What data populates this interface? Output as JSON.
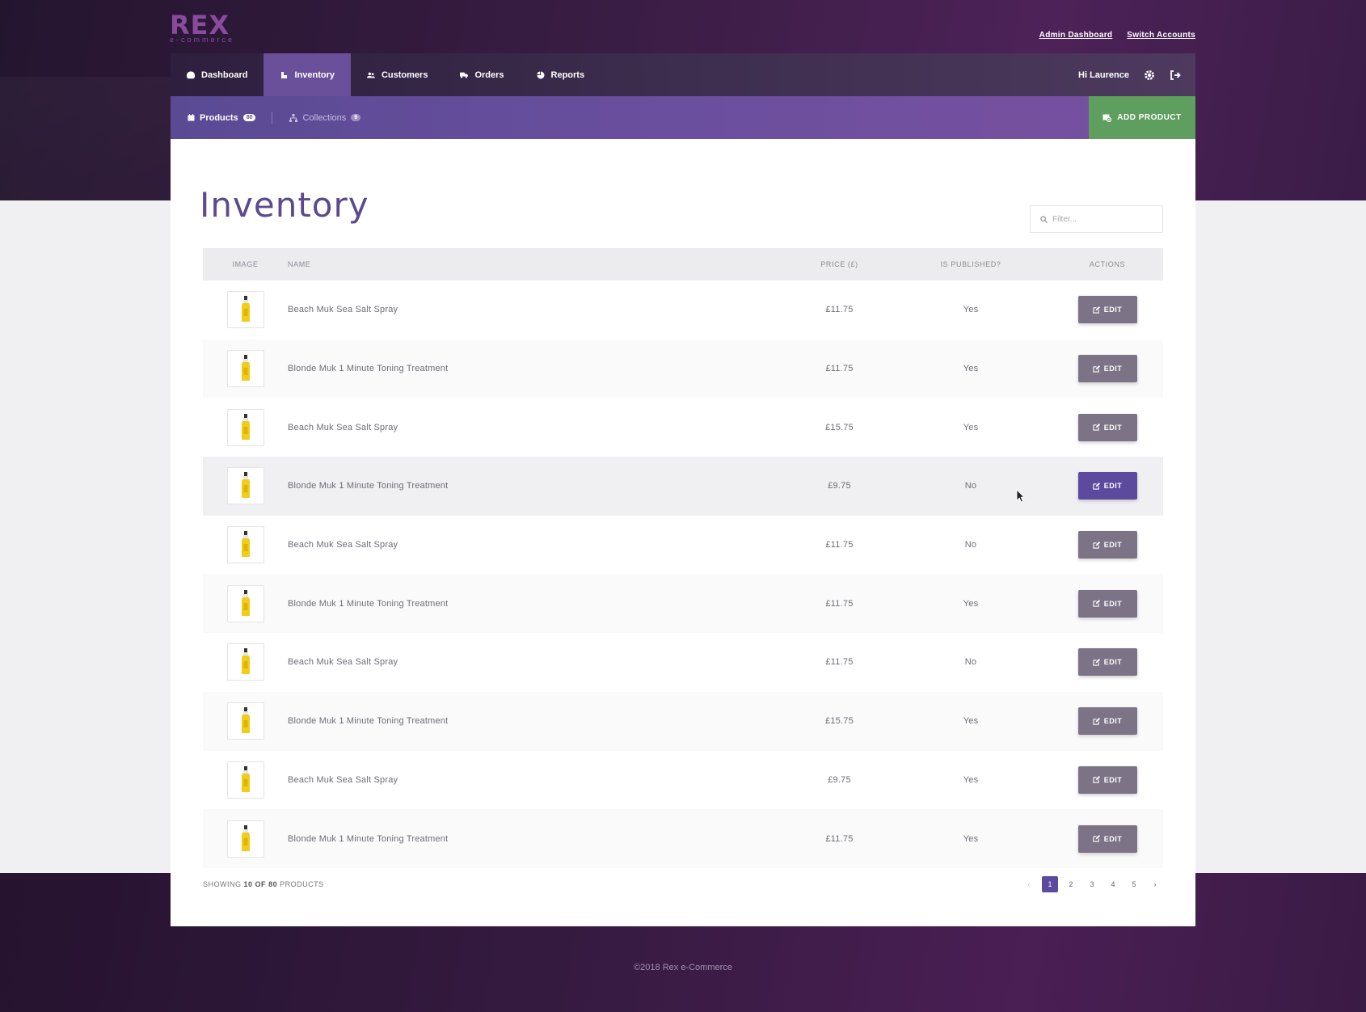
{
  "brand": {
    "name": "REX",
    "sub": "e-commerce",
    "color": "#8a4a9e"
  },
  "top_links": [
    "Admin Dashboard",
    "Switch Accounts"
  ],
  "nav": {
    "items": [
      {
        "label": "Dashboard",
        "icon": "dashboard-icon"
      },
      {
        "label": "Inventory",
        "icon": "inventory-icon",
        "active": true
      },
      {
        "label": "Customers",
        "icon": "customers-icon"
      },
      {
        "label": "Orders",
        "icon": "truck-icon"
      },
      {
        "label": "Reports",
        "icon": "pie-chart-icon"
      }
    ],
    "greeting": "Hi Laurence"
  },
  "subnav": {
    "products": {
      "label": "Products",
      "count": "80"
    },
    "collections": {
      "label": "Collections",
      "count": "9"
    },
    "add_button": "ADD PRODUCT"
  },
  "page": {
    "title": "Inventory",
    "filter_placeholder": "Filter..."
  },
  "table": {
    "headers": {
      "image": "IMAGE",
      "name": "NAME",
      "price": "PRICE (£)",
      "published": "IS PUBLISHED?",
      "actions": "ACTIONS"
    },
    "edit_label": "EDIT",
    "rows": [
      {
        "name": "Beach Muk Sea Salt Spray",
        "price": "£11.75",
        "published": "Yes"
      },
      {
        "name": "Blonde Muk 1 Minute Toning Treatment",
        "price": "£11.75",
        "published": "Yes"
      },
      {
        "name": "Beach Muk Sea Salt Spray",
        "price": "£15.75",
        "published": "Yes"
      },
      {
        "name": "Blonde Muk 1 Minute Toning Treatment",
        "price": "£9.75",
        "published": "No"
      },
      {
        "name": "Beach Muk Sea Salt Spray",
        "price": "£11.75",
        "published": "No"
      },
      {
        "name": "Blonde Muk 1 Minute Toning Treatment",
        "price": "£11.75",
        "published": "Yes"
      },
      {
        "name": "Beach Muk Sea Salt Spray",
        "price": "£11.75",
        "published": "No"
      },
      {
        "name": "Blonde Muk 1 Minute Toning Treatment",
        "price": "£15.75",
        "published": "Yes"
      },
      {
        "name": "Beach Muk Sea Salt Spray",
        "price": "£9.75",
        "published": "Yes"
      },
      {
        "name": "Blonde Muk 1 Minute Toning Treatment",
        "price": "£11.75",
        "published": "Yes"
      }
    ]
  },
  "pagination": {
    "showing_prefix": "SHOWING",
    "shown": "10",
    "of": "OF",
    "total": "80",
    "suffix": "PRODUCTS",
    "pages": [
      "1",
      "2",
      "3",
      "4",
      "5"
    ],
    "current": "1"
  },
  "footer": {
    "copyright": "©2018 Rex e-Commerce"
  },
  "colors": {
    "accent": "#5c4a9e",
    "success": "#5e9e5e",
    "yes": "#5d9d4e",
    "no": "#d9534f"
  }
}
